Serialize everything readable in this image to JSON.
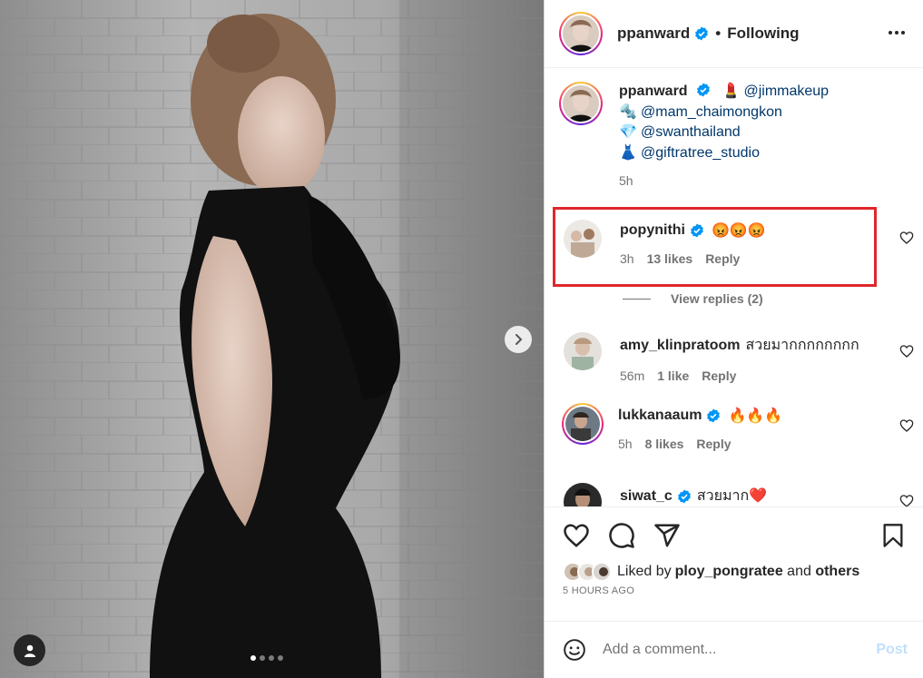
{
  "header": {
    "username": "ppanward",
    "separator": "•",
    "follow_status": "Following"
  },
  "caption": {
    "username": "ppanward",
    "lines": [
      {
        "emoji": "💄",
        "mention": "@jimmakeup"
      },
      {
        "emoji": "🔩",
        "mention": "@mam_chaimongkon"
      },
      {
        "emoji": "💎",
        "mention": "@swanthailand"
      },
      {
        "emoji": "👗",
        "mention": "@giftratree_studio"
      }
    ],
    "time": "5h"
  },
  "comments": [
    {
      "username": "popynithi",
      "text": "😡😡😡",
      "time": "3h",
      "likes": "13 likes",
      "reply": "Reply",
      "verified": true
    },
    {
      "username": "amy_klinpratoom",
      "text": "สวยมากกกกกกกก",
      "time": "56m",
      "likes": "1 like",
      "reply": "Reply",
      "verified": false
    },
    {
      "username": "lukkanaaum",
      "text": "🔥🔥🔥",
      "time": "5h",
      "likes": "8 likes",
      "reply": "Reply",
      "verified": true
    },
    {
      "username": "siwat_c",
      "text": "สวยมาก❤️",
      "verified": true
    }
  ],
  "view_replies": "View replies (2)",
  "likes": {
    "prefix": "Liked by ",
    "user": "ploy_pongratee",
    "and": " and ",
    "others": "others"
  },
  "posted_time": "5 HOURS AGO",
  "add_comment": {
    "placeholder": "Add a comment...",
    "post_label": "Post"
  },
  "carousel": {
    "count": 4,
    "active": 0
  },
  "colors": {
    "verified": "#0095f6",
    "highlight": "#e0262b",
    "mention": "#00376b",
    "post_disabled": "#c0dffd"
  }
}
